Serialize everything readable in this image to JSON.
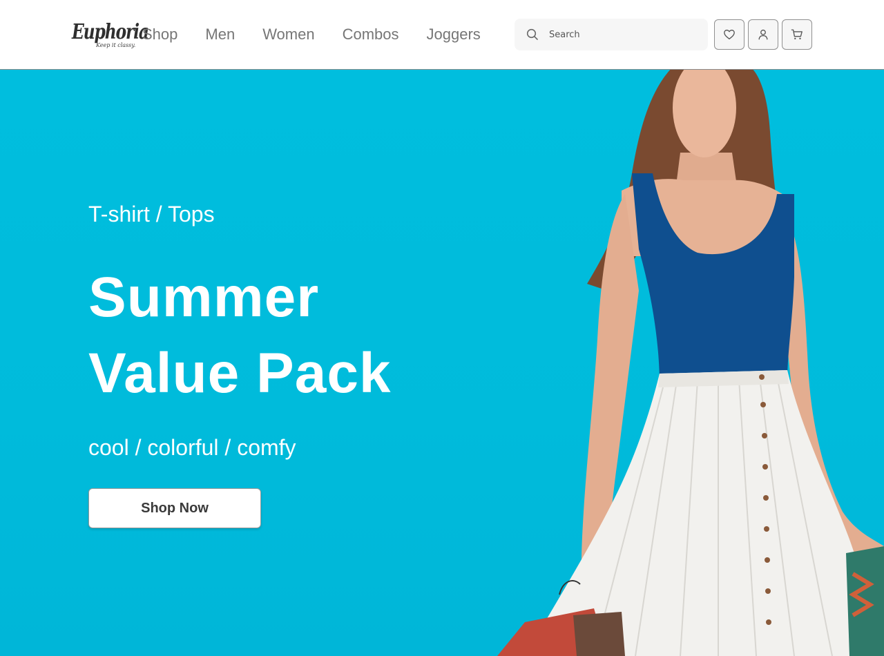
{
  "brand": {
    "name": "Euphoria",
    "tagline": "Keep it classy."
  },
  "nav": {
    "items": [
      {
        "label": "Shop"
      },
      {
        "label": "Men"
      },
      {
        "label": "Women"
      },
      {
        "label": "Combos"
      },
      {
        "label": "Joggers"
      }
    ]
  },
  "search": {
    "placeholder": "Search",
    "value": "",
    "icon": "search-icon"
  },
  "actions": {
    "wishlist_icon": "heart-icon",
    "account_icon": "user-icon",
    "cart_icon": "cart-icon"
  },
  "hero": {
    "category": "T-shirt / Tops",
    "title_line1": "Summer",
    "title_line2": "Value Pack",
    "subtitle": "cool / colorful / comfy",
    "cta_label": "Shop Now",
    "background_color": "#00bcdc"
  }
}
